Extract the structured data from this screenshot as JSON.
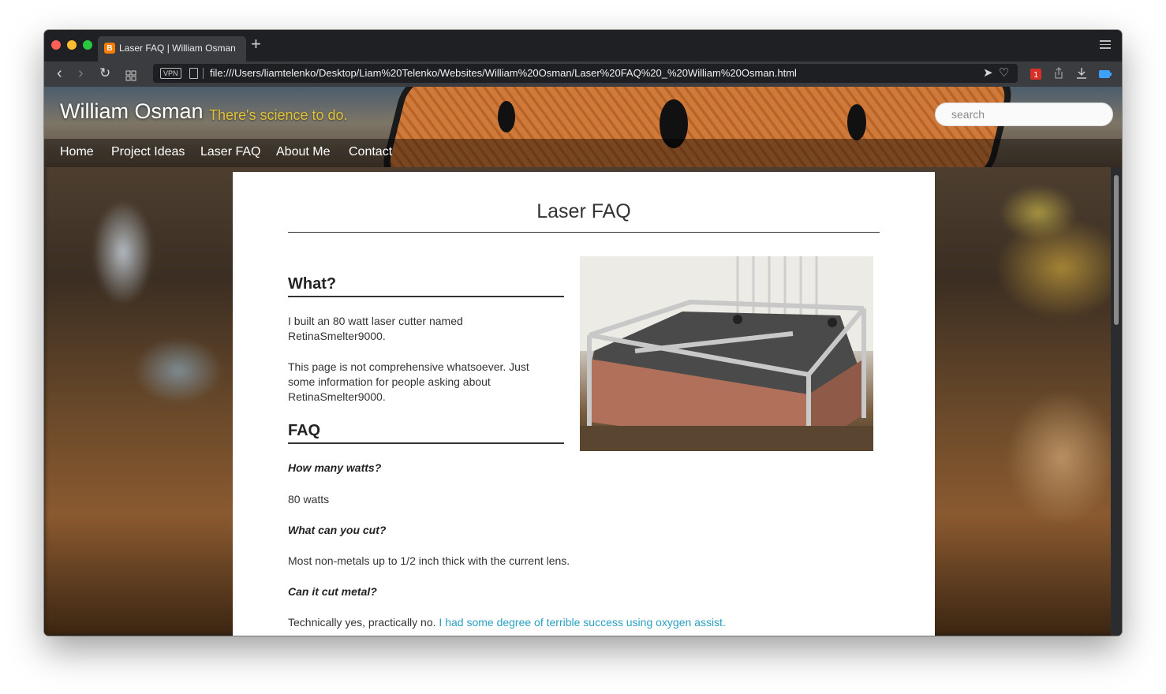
{
  "browser": {
    "tab_title": "Laser FAQ | William Osman",
    "url": "file:///Users/liamtelenko/Desktop/Liam%20Telenko/Websites/William%20Osman/Laser%20FAQ%20_%20William%20Osman.html",
    "vpn_label": "VPN",
    "new_tab_label": "+"
  },
  "site": {
    "title": "William Osman",
    "tagline": "There's science to do.",
    "search_placeholder": "search",
    "nav": [
      "Home",
      "Project Ideas",
      "Laser FAQ",
      "About Me",
      "Contact"
    ]
  },
  "article": {
    "title": "Laser FAQ",
    "what_heading": "What?",
    "what_p1": "I built an 80 watt laser cutter named RetinaSmelter9000.",
    "what_p2": "This page is not comprehensive whatsoever. Just some information for people asking about RetinaSmelter9000.",
    "faq_heading": "FAQ",
    "faq": [
      {
        "q": "How many watts?",
        "a": "80 watts"
      },
      {
        "q": "What can you cut?",
        "a": "Most non-metals up to 1/2 inch thick with the current lens."
      },
      {
        "q": "Can it cut metal?",
        "a": "Technically yes, practically no.",
        "link": "I had some degree of terrible success using oxygen assist."
      }
    ]
  },
  "colors": {
    "link": "#2a9fc0",
    "tagline": "#e0c23a",
    "chrome_dark": "#1f2023"
  },
  "icons": [
    "back-icon",
    "forward-icon",
    "reload-icon",
    "grid-icon",
    "page-icon",
    "send-icon",
    "heart-icon",
    "share-icon",
    "download-icon",
    "battery-icon",
    "tab-menu-icon",
    "blogger-icon"
  ]
}
